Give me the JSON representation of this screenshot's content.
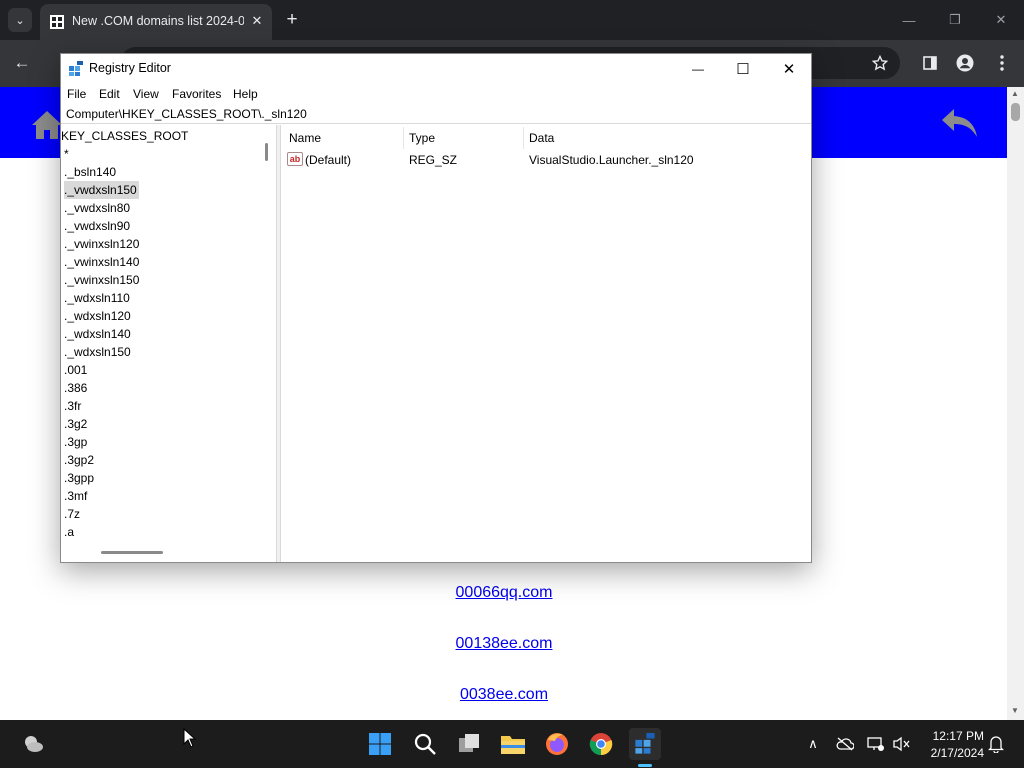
{
  "browser": {
    "tab_list_glyph": "⌄",
    "tab_title": "New .COM domains list 2024-0",
    "tab_close": "✕",
    "new_tab": "+",
    "minimize": "—",
    "restore": "❐",
    "close": "✕",
    "back": "←"
  },
  "page": {
    "banner_color": "#0000ff",
    "domains": [
      "00066qq.com",
      "00138ee.com",
      "0038ee.com"
    ]
  },
  "regedit": {
    "title": "Registry Editor",
    "menu": [
      "File",
      "Edit",
      "View",
      "Favorites",
      "Help"
    ],
    "address": "Computer\\HKEY_CLASSES_ROOT\\._sln120",
    "tree_items": [
      "KEY_CLASSES_ROOT",
      "*",
      "._bsln140",
      "._vwdxsln150",
      "._vwdxsln80",
      "._vwdxsln90",
      "._vwinxsln120",
      "._vwinxsln140",
      "._vwinxsln150",
      "._wdxsln110",
      "._wdxsln120",
      "._wdxsln140",
      "._wdxsln150",
      ".001",
      ".386",
      ".3fr",
      ".3g2",
      ".3gp",
      ".3gp2",
      ".3gpp",
      ".3mf",
      ".7z",
      ".a"
    ],
    "selected_index": 3,
    "columns": {
      "name": "Name",
      "type": "Type",
      "data": "Data"
    },
    "value": {
      "name": "(Default)",
      "type": "REG_SZ",
      "data": "VisualStudio.Launcher._sln120",
      "icon_text": "ab"
    },
    "controls": {
      "minimize": "—",
      "maximize": "☐",
      "close": "✕"
    }
  },
  "taskbar": {
    "time": "12:17 PM",
    "date": "2/17/2024",
    "tray_overflow": "∧"
  }
}
